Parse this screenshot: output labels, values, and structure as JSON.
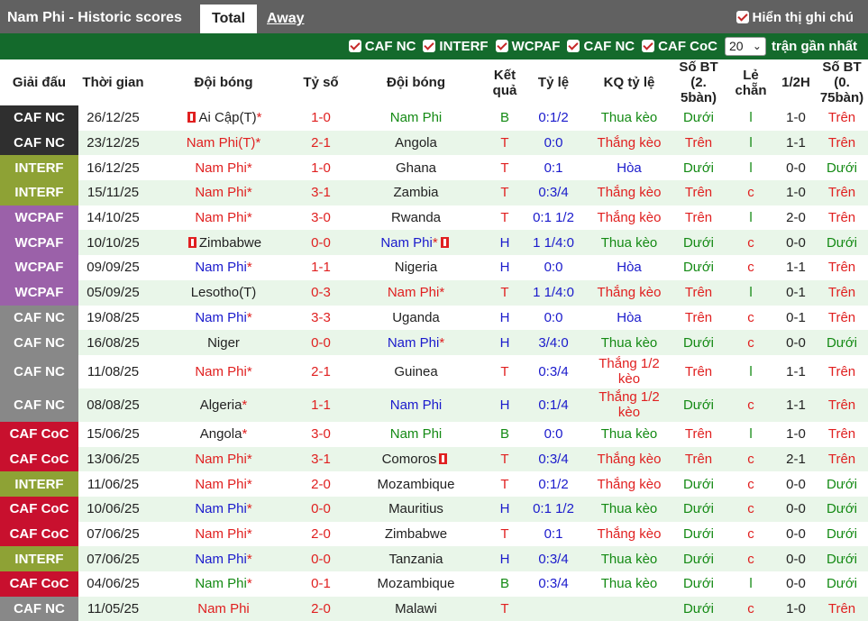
{
  "header": {
    "title": "Nam Phi - Historic scores",
    "tab_total": "Total",
    "tab_away": "Away",
    "show_label": "Hiển thị ghi chú"
  },
  "filters": {
    "items": [
      "CAF NC",
      "INTERF",
      "WCPAF",
      "CAF NC",
      "CAF CoC"
    ],
    "count_value": "20",
    "recent_label": "trận gần nhất"
  },
  "columns": [
    "Giải đấu",
    "Thời gian",
    "Đội bóng",
    "Tỷ số",
    "Đội bóng",
    "Kết quả",
    "Tỷ lệ",
    "KQ tỷ lệ",
    "Số BT (2. 5bàn)",
    "Lẻ chẵn",
    "1/2H",
    "Số BT (0. 75bàn)"
  ],
  "colors": {
    "CAF NC": "#333333",
    "INTERF": "#8ea235",
    "WCPAF": "#9b61a9",
    "CAF NC grey": "#888888",
    "CAF CoC": "#c8102e",
    "header_bg": "#616161",
    "filter_bg": "#146a2c"
  },
  "rows": [
    {
      "league": "CAF NC",
      "lcolor": "#2f2f2f",
      "date": "26/12/25",
      "home": "Ai Cập(T)",
      "home_star": "*",
      "home_flag": true,
      "home_color": "dark",
      "score": "1-0",
      "away": "Nam Phi",
      "away_star": "",
      "away_flag": false,
      "away_color": "green",
      "result": "B",
      "res_color": "green",
      "odds": "0:1/2",
      "odds_res": "Thua kèo",
      "ores_color": "green",
      "ou": "Dưới",
      "ou_color": "green",
      "oe": "l",
      "oe_color": "green",
      "half": "1-0",
      "ou2": "Trên",
      "ou2_color": "red"
    },
    {
      "league": "CAF NC",
      "lcolor": "#2f2f2f",
      "date": "23/12/25",
      "home": "Nam Phi(T)",
      "home_star": "*",
      "home_flag": false,
      "home_color": "red",
      "score": "2-1",
      "away": "Angola",
      "away_star": "",
      "away_flag": false,
      "away_color": "dark",
      "result": "T",
      "res_color": "red",
      "odds": "0:0",
      "odds_res": "Thắng kèo",
      "ores_color": "red",
      "ou": "Trên",
      "ou_color": "red",
      "oe": "l",
      "oe_color": "green",
      "half": "1-1",
      "ou2": "Trên",
      "ou2_color": "red"
    },
    {
      "league": "INTERF",
      "lcolor": "#8ea235",
      "date": "16/12/25",
      "home": "Nam Phi",
      "home_star": "*",
      "home_flag": false,
      "home_color": "red",
      "score": "1-0",
      "away": "Ghana",
      "away_star": "",
      "away_flag": false,
      "away_color": "dark",
      "result": "T",
      "res_color": "red",
      "odds": "0:1",
      "odds_res": "Hòa",
      "ores_color": "blue",
      "ou": "Dưới",
      "ou_color": "green",
      "oe": "l",
      "oe_color": "green",
      "half": "0-0",
      "ou2": "Dưới",
      "ou2_color": "green"
    },
    {
      "league": "INTERF",
      "lcolor": "#8ea235",
      "date": "15/11/25",
      "home": "Nam Phi",
      "home_star": "*",
      "home_flag": false,
      "home_color": "red",
      "score": "3-1",
      "away": "Zambia",
      "away_star": "",
      "away_flag": false,
      "away_color": "dark",
      "result": "T",
      "res_color": "red",
      "odds": "0:3/4",
      "odds_res": "Thắng kèo",
      "ores_color": "red",
      "ou": "Trên",
      "ou_color": "red",
      "oe": "c",
      "oe_color": "red",
      "half": "1-0",
      "ou2": "Trên",
      "ou2_color": "red"
    },
    {
      "league": "WCPAF",
      "lcolor": "#9b61a9",
      "date": "14/10/25",
      "home": "Nam Phi",
      "home_star": "*",
      "home_flag": false,
      "home_color": "red",
      "score": "3-0",
      "away": "Rwanda",
      "away_star": "",
      "away_flag": false,
      "away_color": "dark",
      "result": "T",
      "res_color": "red",
      "odds": "0:1 1/2",
      "odds_res": "Thắng kèo",
      "ores_color": "red",
      "ou": "Trên",
      "ou_color": "red",
      "oe": "l",
      "oe_color": "green",
      "half": "2-0",
      "ou2": "Trên",
      "ou2_color": "red"
    },
    {
      "league": "WCPAF",
      "lcolor": "#9b61a9",
      "date": "10/10/25",
      "home": "Zimbabwe",
      "home_star": "",
      "home_flag": true,
      "home_color": "dark",
      "score": "0-0",
      "away": "Nam Phi",
      "away_star": "*",
      "away_flag": true,
      "away_color": "blue",
      "result": "H",
      "res_color": "blue",
      "odds": "1 1/4:0",
      "odds_res": "Thua kèo",
      "ores_color": "green",
      "ou": "Dưới",
      "ou_color": "green",
      "oe": "c",
      "oe_color": "red",
      "half": "0-0",
      "ou2": "Dưới",
      "ou2_color": "green"
    },
    {
      "league": "WCPAF",
      "lcolor": "#9b61a9",
      "date": "09/09/25",
      "home": "Nam Phi",
      "home_star": "*",
      "home_flag": false,
      "home_color": "blue",
      "score": "1-1",
      "away": "Nigeria",
      "away_star": "",
      "away_flag": false,
      "away_color": "dark",
      "result": "H",
      "res_color": "blue",
      "odds": "0:0",
      "odds_res": "Hòa",
      "ores_color": "blue",
      "ou": "Dưới",
      "ou_color": "green",
      "oe": "c",
      "oe_color": "red",
      "half": "1-1",
      "ou2": "Trên",
      "ou2_color": "red"
    },
    {
      "league": "WCPAF",
      "lcolor": "#9b61a9",
      "date": "05/09/25",
      "home": "Lesotho(T)",
      "home_star": "",
      "home_flag": false,
      "home_color": "dark",
      "score": "0-3",
      "away": "Nam Phi",
      "away_star": "*",
      "away_flag": false,
      "away_color": "red",
      "result": "T",
      "res_color": "red",
      "odds": "1 1/4:0",
      "odds_res": "Thắng kèo",
      "ores_color": "red",
      "ou": "Trên",
      "ou_color": "red",
      "oe": "l",
      "oe_color": "green",
      "half": "0-1",
      "ou2": "Trên",
      "ou2_color": "red"
    },
    {
      "league": "CAF NC",
      "lcolor": "#888888",
      "date": "19/08/25",
      "home": "Nam Phi",
      "home_star": "*",
      "home_flag": false,
      "home_color": "blue",
      "score": "3-3",
      "away": "Uganda",
      "away_star": "",
      "away_flag": false,
      "away_color": "dark",
      "result": "H",
      "res_color": "blue",
      "odds": "0:0",
      "odds_res": "Hòa",
      "ores_color": "blue",
      "ou": "Trên",
      "ou_color": "red",
      "oe": "c",
      "oe_color": "red",
      "half": "0-1",
      "ou2": "Trên",
      "ou2_color": "red"
    },
    {
      "league": "CAF NC",
      "lcolor": "#888888",
      "date": "16/08/25",
      "home": "Niger",
      "home_star": "",
      "home_flag": false,
      "home_color": "dark",
      "score": "0-0",
      "away": "Nam Phi",
      "away_star": "*",
      "away_flag": false,
      "away_color": "blue",
      "result": "H",
      "res_color": "blue",
      "odds": "3/4:0",
      "odds_res": "Thua kèo",
      "ores_color": "green",
      "ou": "Dưới",
      "ou_color": "green",
      "oe": "c",
      "oe_color": "red",
      "half": "0-0",
      "ou2": "Dưới",
      "ou2_color": "green"
    },
    {
      "league": "CAF NC",
      "lcolor": "#888888",
      "date": "11/08/25",
      "home": "Nam Phi",
      "home_star": "*",
      "home_flag": false,
      "home_color": "red",
      "score": "2-1",
      "away": "Guinea",
      "away_star": "",
      "away_flag": false,
      "away_color": "dark",
      "result": "T",
      "res_color": "red",
      "odds": "0:3/4",
      "odds_res": "Thắng 1/2 kèo",
      "ores_color": "red",
      "ou": "Trên",
      "ou_color": "red",
      "oe": "l",
      "oe_color": "green",
      "half": "1-1",
      "ou2": "Trên",
      "ou2_color": "red",
      "tall": true
    },
    {
      "league": "CAF NC",
      "lcolor": "#888888",
      "date": "08/08/25",
      "home": "Algeria",
      "home_star": "*",
      "home_flag": false,
      "home_color": "dark",
      "score": "1-1",
      "away": "Nam Phi",
      "away_star": "",
      "away_flag": false,
      "away_color": "blue",
      "result": "H",
      "res_color": "blue",
      "odds": "0:1/4",
      "odds_res": "Thắng 1/2 kèo",
      "ores_color": "red",
      "ou": "Dưới",
      "ou_color": "green",
      "oe": "c",
      "oe_color": "red",
      "half": "1-1",
      "ou2": "Trên",
      "ou2_color": "red",
      "tall": true
    },
    {
      "league": "CAF CoC",
      "lcolor": "#c8102e",
      "date": "15/06/25",
      "home": "Angola",
      "home_star": "*",
      "home_flag": false,
      "home_color": "dark",
      "score": "3-0",
      "away": "Nam Phi",
      "away_star": "",
      "away_flag": false,
      "away_color": "green",
      "result": "B",
      "res_color": "green",
      "odds": "0:0",
      "odds_res": "Thua kèo",
      "ores_color": "green",
      "ou": "Trên",
      "ou_color": "red",
      "oe": "l",
      "oe_color": "green",
      "half": "1-0",
      "ou2": "Trên",
      "ou2_color": "red"
    },
    {
      "league": "CAF CoC",
      "lcolor": "#c8102e",
      "date": "13/06/25",
      "home": "Nam Phi",
      "home_star": "*",
      "home_flag": false,
      "home_color": "red",
      "score": "3-1",
      "away": "Comoros",
      "away_star": "",
      "away_flag": true,
      "away_color": "dark",
      "result": "T",
      "res_color": "red",
      "odds": "0:3/4",
      "odds_res": "Thắng kèo",
      "ores_color": "red",
      "ou": "Trên",
      "ou_color": "red",
      "oe": "c",
      "oe_color": "red",
      "half": "2-1",
      "ou2": "Trên",
      "ou2_color": "red"
    },
    {
      "league": "INTERF",
      "lcolor": "#8ea235",
      "date": "11/06/25",
      "home": "Nam Phi",
      "home_star": "*",
      "home_flag": false,
      "home_color": "red",
      "score": "2-0",
      "away": "Mozambique",
      "away_star": "",
      "away_flag": false,
      "away_color": "dark",
      "result": "T",
      "res_color": "red",
      "odds": "0:1/2",
      "odds_res": "Thắng kèo",
      "ores_color": "red",
      "ou": "Dưới",
      "ou_color": "green",
      "oe": "c",
      "oe_color": "red",
      "half": "0-0",
      "ou2": "Dưới",
      "ou2_color": "green"
    },
    {
      "league": "CAF CoC",
      "lcolor": "#c8102e",
      "date": "10/06/25",
      "home": "Nam Phi",
      "home_star": "*",
      "home_flag": false,
      "home_color": "blue",
      "score": "0-0",
      "away": "Mauritius",
      "away_star": "",
      "away_flag": false,
      "away_color": "dark",
      "result": "H",
      "res_color": "blue",
      "odds": "0:1 1/2",
      "odds_res": "Thua kèo",
      "ores_color": "green",
      "ou": "Dưới",
      "ou_color": "green",
      "oe": "c",
      "oe_color": "red",
      "half": "0-0",
      "ou2": "Dưới",
      "ou2_color": "green"
    },
    {
      "league": "CAF CoC",
      "lcolor": "#c8102e",
      "date": "07/06/25",
      "home": "Nam Phi",
      "home_star": "*",
      "home_flag": false,
      "home_color": "red",
      "score": "2-0",
      "away": "Zimbabwe",
      "away_star": "",
      "away_flag": false,
      "away_color": "dark",
      "result": "T",
      "res_color": "red",
      "odds": "0:1",
      "odds_res": "Thắng kèo",
      "ores_color": "red",
      "ou": "Dưới",
      "ou_color": "green",
      "oe": "c",
      "oe_color": "red",
      "half": "0-0",
      "ou2": "Dưới",
      "ou2_color": "green"
    },
    {
      "league": "INTERF",
      "lcolor": "#8ea235",
      "date": "07/06/25",
      "home": "Nam Phi",
      "home_star": "*",
      "home_flag": false,
      "home_color": "blue",
      "score": "0-0",
      "away": "Tanzania",
      "away_star": "",
      "away_flag": false,
      "away_color": "dark",
      "result": "H",
      "res_color": "blue",
      "odds": "0:3/4",
      "odds_res": "Thua kèo",
      "ores_color": "green",
      "ou": "Dưới",
      "ou_color": "green",
      "oe": "c",
      "oe_color": "red",
      "half": "0-0",
      "ou2": "Dưới",
      "ou2_color": "green"
    },
    {
      "league": "CAF CoC",
      "lcolor": "#c8102e",
      "date": "04/06/25",
      "home": "Nam Phi",
      "home_star": "*",
      "home_flag": false,
      "home_color": "green",
      "score": "0-1",
      "away": "Mozambique",
      "away_star": "",
      "away_flag": false,
      "away_color": "dark",
      "result": "B",
      "res_color": "green",
      "odds": "0:3/4",
      "odds_res": "Thua kèo",
      "ores_color": "green",
      "ou": "Dưới",
      "ou_color": "green",
      "oe": "l",
      "oe_color": "green",
      "half": "0-0",
      "ou2": "Dưới",
      "ou2_color": "green"
    },
    {
      "league": "CAF NC",
      "lcolor": "#888888",
      "date": "11/05/25",
      "home": "Nam Phi",
      "home_star": "",
      "home_flag": false,
      "home_color": "red",
      "score": "2-0",
      "away": "Malawi",
      "away_star": "",
      "away_flag": false,
      "away_color": "dark",
      "result": "T",
      "res_color": "red",
      "odds": "",
      "odds_res": "",
      "ores_color": "red",
      "ou": "Dưới",
      "ou_color": "green",
      "oe": "c",
      "oe_color": "red",
      "half": "1-0",
      "ou2": "Trên",
      "ou2_color": "red"
    }
  ]
}
